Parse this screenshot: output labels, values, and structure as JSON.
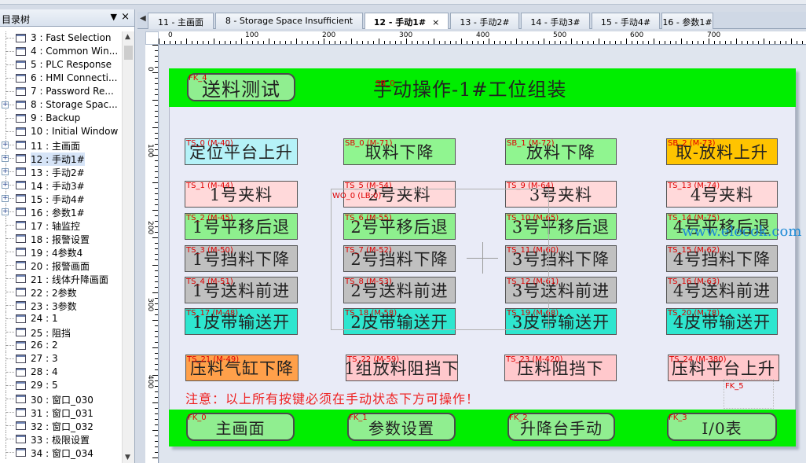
{
  "tree": {
    "title": "目录树",
    "pin": "▼",
    "close": "×",
    "items": [
      {
        "label": "3 : Fast Selection",
        "expand": false
      },
      {
        "label": "4 : Common Win...",
        "expand": false
      },
      {
        "label": "5 : PLC Response",
        "expand": false
      },
      {
        "label": "6 : HMI Connecti...",
        "expand": false
      },
      {
        "label": "7 : Password Re...",
        "expand": false
      },
      {
        "label": "8 : Storage Spac...",
        "expand": true
      },
      {
        "label": "9 : Backup",
        "expand": false
      },
      {
        "label": "10 : Initial Window",
        "expand": false
      },
      {
        "label": "11 : 主画面",
        "expand": true
      },
      {
        "label": "12 : 手动1#",
        "expand": true,
        "selected": true
      },
      {
        "label": "13 : 手动2#",
        "expand": true
      },
      {
        "label": "14 : 手动3#",
        "expand": true
      },
      {
        "label": "15 : 手动4#",
        "expand": true
      },
      {
        "label": "16 : 参数1#",
        "expand": true
      },
      {
        "label": "17 : 轴监控",
        "expand": false
      },
      {
        "label": "18 : 报警设置",
        "expand": false
      },
      {
        "label": "19 : 4参数4",
        "expand": false
      },
      {
        "label": "20 : 报警画面",
        "expand": false
      },
      {
        "label": "21 : 线体升降画面",
        "expand": false
      },
      {
        "label": "22 : 2参数",
        "expand": false
      },
      {
        "label": "23 : 3参数",
        "expand": false
      },
      {
        "label": "24 : 1",
        "expand": false
      },
      {
        "label": "25 : 阻挡",
        "expand": false
      },
      {
        "label": "26 : 2",
        "expand": false
      },
      {
        "label": "27 : 3",
        "expand": false
      },
      {
        "label": "28 : 4",
        "expand": false
      },
      {
        "label": "29 : 5",
        "expand": false
      },
      {
        "label": "30 : 窗口_030",
        "expand": false
      },
      {
        "label": "31 : 窗口_031",
        "expand": false
      },
      {
        "label": "32 : 窗口_032",
        "expand": false
      },
      {
        "label": "33 : 极限设置",
        "expand": false
      },
      {
        "label": "34 : 窗口_034",
        "expand": false
      }
    ]
  },
  "tabs": [
    {
      "label": "11 - 主画面",
      "active": false
    },
    {
      "label": "8 - Storage Space Insufficient",
      "active": false
    },
    {
      "label": "12 - 手动1#",
      "active": true,
      "close": "×"
    },
    {
      "label": "13 - 手动2#",
      "active": false
    },
    {
      "label": "14 - 手动3#",
      "active": false
    },
    {
      "label": "15 - 手动4#",
      "active": false
    },
    {
      "label": "16 - 参数1#",
      "active": false
    }
  ],
  "tab_nav": "◀",
  "ruler": {
    "h_labels": [
      "0",
      "100",
      "200",
      "300",
      "400",
      "500",
      "600",
      "700"
    ],
    "v_labels": [
      "0",
      "100",
      "200",
      "300",
      "400"
    ]
  },
  "screen": {
    "title": "手动操作-1#工位组装",
    "note": "注意：以上所有按键必须在手动状态下方可操作！",
    "watermark": "www.elecok.com",
    "header_button": {
      "label": "送料测试",
      "tag": "FK_4"
    },
    "title_tag": "SB_0",
    "cursor_tag": "WO_0 (LB:0)",
    "fk5_tag": "FK_5",
    "buttons": [
      {
        "label": "定位平台上升",
        "tag": "TS_0 (M-40)",
        "color": "#b5f2f8"
      },
      {
        "label": "取料下降",
        "tag": "SB_0 (M-71)",
        "color": "#90f590"
      },
      {
        "label": "放料下降",
        "tag": "SB_1 (M-72)",
        "color": "#90f590"
      },
      {
        "label": "取-放料上升",
        "tag": "SB_2 (M-73)",
        "color": "#ffc400"
      },
      {
        "label": "1号夹料",
        "tag": "TS_1 (M-44)",
        "color": "#ffd9da"
      },
      {
        "label": "2号夹料",
        "tag": "TS_5 (M-54)",
        "color": "#ffd9da"
      },
      {
        "label": "3号夹料",
        "tag": "TS_9 (M-64)",
        "color": "#ffd9da"
      },
      {
        "label": "4号夹料",
        "tag": "TS_13 (M-74)",
        "color": "#ffd9da"
      },
      {
        "label": "1号平移后退",
        "tag": "TS_2 (M-45)",
        "color": "#8ef08e"
      },
      {
        "label": "2号平移后退",
        "tag": "TS_6 (M-55)",
        "color": "#8ef08e"
      },
      {
        "label": "3号平移后退",
        "tag": "TS_10 (M-65)",
        "color": "#8ef08e"
      },
      {
        "label": "4号平移后退",
        "tag": "TS_14 (M-75)",
        "color": "#8ef08e"
      },
      {
        "label": "1号挡料下降",
        "tag": "TS_3 (M-50)",
        "color": "#c0c0c0"
      },
      {
        "label": "2号挡料下降",
        "tag": "TS_7 (M-52)",
        "color": "#c0c0c0"
      },
      {
        "label": "3号挡料下降",
        "tag": "TS_11 (M-60)",
        "color": "#c0c0c0"
      },
      {
        "label": "4号挡料下降",
        "tag": "TS_15 (M-62)",
        "color": "#c0c0c0"
      },
      {
        "label": "1号送料前进",
        "tag": "TS_4 (M-51)",
        "color": "#c0c0c0"
      },
      {
        "label": "2号送料前进",
        "tag": "TS_8 (M-53)",
        "color": "#c0c0c0"
      },
      {
        "label": "3号送料前进",
        "tag": "TS_12 (M-61)",
        "color": "#c0c0c0"
      },
      {
        "label": "4号送料前进",
        "tag": "TS_16 (M-63)",
        "color": "#c0c0c0"
      },
      {
        "label": "1皮带输送开",
        "tag": "TS_17 (M-48)",
        "color": "#2ee6cf"
      },
      {
        "label": "2皮带输送开",
        "tag": "TS_18 (M-58)",
        "color": "#2ee6cf"
      },
      {
        "label": "3皮带输送开",
        "tag": "TS_19 (M-68)",
        "color": "#2ee6cf"
      },
      {
        "label": "4皮带输送开",
        "tag": "TS_20 (M-78)",
        "color": "#2ee6cf"
      },
      {
        "label": "压料气缸下降",
        "tag": "TS_21 (M-49)",
        "color": "#ffa04a"
      },
      {
        "label": "1组放料阻挡下",
        "tag": "TS_22 (M-59)",
        "color": "#ffc8cc"
      },
      {
        "label": "压料阻挡下",
        "tag": "TS_23 (M-420)",
        "color": "#ffc8cc"
      },
      {
        "label": "压料平台上升",
        "tag": "TS_24 (M-380)",
        "color": "#ffc8cc"
      }
    ],
    "footer_buttons": [
      {
        "label": "主画面",
        "tag": "FK_0"
      },
      {
        "label": "参数设置",
        "tag": "FK_1"
      },
      {
        "label": "升降台手动",
        "tag": "FK_2"
      },
      {
        "label": "I/0表",
        "tag": "FK_3"
      }
    ]
  },
  "colors": {
    "band": "#00ee00",
    "tag": "#e00000",
    "note": "#ee2222"
  }
}
